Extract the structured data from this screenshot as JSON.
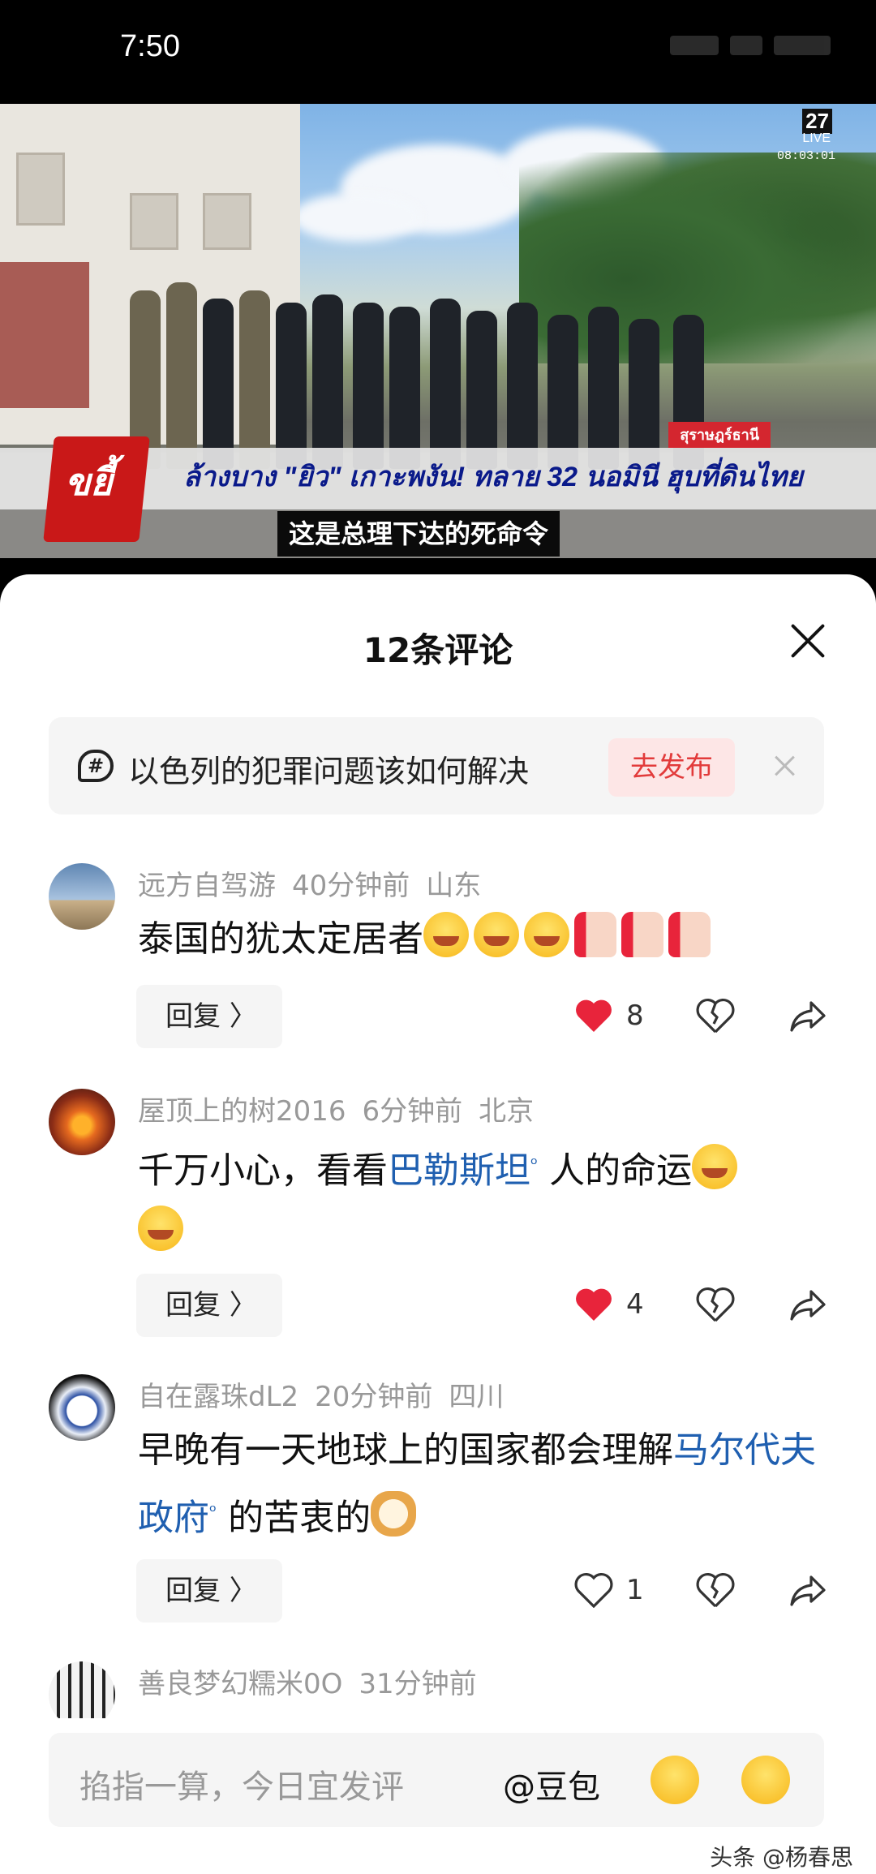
{
  "status_bar": {
    "time": "7:50"
  },
  "video": {
    "channel_number": "27",
    "live_label": "LIVE",
    "clock": "08:03:01",
    "location_tag": "สุราษฎร์ธานี",
    "logo_text": "ขยี้",
    "headline": "ล้างบาง \"ยิว\" เกาะพงัน! ทลาย 32 นอมินี ฮุบที่ดินไทย",
    "subtitle": "这是总理下达的死命令"
  },
  "sheet": {
    "title": "12条评论",
    "topic": {
      "text": "以色列的犯罪问题该如何解决",
      "icon_text": "#",
      "publish_label": "去发布"
    }
  },
  "comments": [
    {
      "user": "远方自驾游",
      "time": "40分钟前",
      "location": "山东",
      "text": "泰国的犹太定居者",
      "reply_label": "回复 〉",
      "likes": "8"
    },
    {
      "user": "屋顶上的树2016",
      "time": "6分钟前",
      "location": "北京",
      "text_before": "千万小心，看看",
      "link": "巴勒斯坦",
      "text_after": " 人的命运",
      "reply_label": "回复 〉",
      "likes": "4"
    },
    {
      "user": "自在露珠dL2",
      "time": "20分钟前",
      "location": "四川",
      "text_before": "早晚有一天地球上的国家都会理解",
      "link": "马尔代夫政府",
      "text_after": " 的苦衷的",
      "reply_label": "回复 〉",
      "likes": "1"
    },
    {
      "user": "善良梦幻糯米0O",
      "time": "31分钟前"
    }
  ],
  "input": {
    "placeholder": "掐指一算，今日宜发评",
    "mention": "@豆包"
  },
  "watermark": "头条 @杨春思",
  "colors": {
    "like_red": "#e8243b",
    "link_blue": "#1f5fb0",
    "publish_red": "#e23b3b"
  }
}
